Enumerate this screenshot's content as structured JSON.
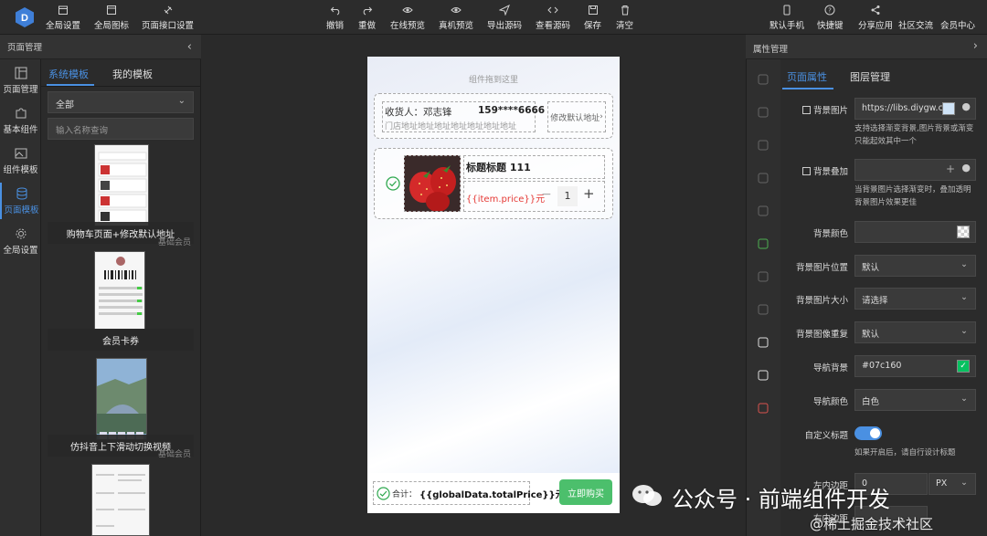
{
  "toolbar": {
    "left": [
      {
        "label": "全局设置",
        "icon": "calendar-icon"
      },
      {
        "label": "全局图标",
        "icon": "window-icon"
      },
      {
        "label": "页面接口设置",
        "icon": "plug-icon"
      }
    ],
    "center": [
      {
        "label": "撤销",
        "icon": "undo-icon"
      },
      {
        "label": "重做",
        "icon": "redo-icon"
      },
      {
        "label": "在线预览",
        "icon": "eye-icon"
      },
      {
        "label": "真机预览",
        "icon": "eye-icon"
      },
      {
        "label": "导出源码",
        "icon": "send-icon"
      },
      {
        "label": "查看源码",
        "icon": "code-icon"
      },
      {
        "label": "保存",
        "icon": "save-icon"
      },
      {
        "label": "清空",
        "icon": "trash-icon"
      }
    ],
    "right": [
      {
        "label": "默认手机",
        "icon": "phone-icon"
      },
      {
        "label": "快捷键",
        "icon": "help-icon"
      },
      {
        "label": "分享应用",
        "icon": "share-icon"
      },
      {
        "label": "社区交流",
        "icon": ""
      },
      {
        "label": "会员中心",
        "icon": ""
      }
    ]
  },
  "left_panel": {
    "title": "页面管理",
    "nav": [
      {
        "label": "页面管理",
        "icon": "layout-icon"
      },
      {
        "label": "基本组件",
        "icon": "puzzle-icon"
      },
      {
        "label": "组件模板",
        "icon": "image-icon"
      },
      {
        "label": "页面模板",
        "icon": "database-icon"
      },
      {
        "label": "全局设置",
        "icon": "gear-icon"
      }
    ],
    "tabs": [
      "系统模板",
      "我的模板"
    ],
    "filter_value": "全部",
    "search_placeholder": "输入名称查询",
    "templates": [
      {
        "name": "购物车页面+修改默认地址",
        "tag": "基础会员"
      },
      {
        "name": "会员卡券",
        "tag": ""
      },
      {
        "name": "仿抖音上下滑动切换视频",
        "tag": "基础会员"
      }
    ]
  },
  "phone": {
    "drop_tip": "组件拖到这里",
    "receiver_label": "收货人：",
    "receiver_name": "邓志锋",
    "receiver_phone": "159****6666",
    "address": "门店地址地址地址地址地址地址地址",
    "edit_address": "修改默认地址",
    "product_title": "标题标题 111",
    "product_price": "{{item.price}}元",
    "quantity": "1",
    "total_label": "合计：",
    "total_value": "{{globalData.totalPrice}}元",
    "buy_button": "立即购买"
  },
  "right_panel": {
    "title": "属性管理",
    "tabs": [
      "页面属性",
      "图层管理"
    ],
    "bg_image_label": "背景图片",
    "bg_image_value": "https://libs.diygw.co",
    "bg_image_hint": "支持选择渐变背景,图片背景或渐变只能起效其中一个",
    "bg_overlay_label": "背景叠加",
    "bg_overlay_hint": "当背景图片选择渐变时，叠加透明背景图片效果更佳",
    "bg_color_label": "背景颜色",
    "bg_position_label": "背景图片位置",
    "bg_position_value": "默认",
    "bg_size_label": "背景图片大小",
    "bg_size_value": "请选择",
    "bg_repeat_label": "背景图像重复",
    "bg_repeat_value": "默认",
    "nav_bg_label": "导航背景",
    "nav_bg_value": "#07c160",
    "nav_color_label": "导航颜色",
    "nav_color_value": "白色",
    "custom_title_label": "自定义标题",
    "custom_title_hint": "如果开启后，请自行设计标题",
    "padding_left_label": "左内边距",
    "padding_left_value": "0",
    "padding_right_label": "右内边距",
    "unit": "PX"
  },
  "watermark": {
    "line1": "公众号 · 前端组件开发",
    "line2": "@稀土掘金技术社区"
  },
  "colors": {
    "accent": "#4a90e2",
    "green": "#07c160",
    "price_red": "#e53935"
  }
}
